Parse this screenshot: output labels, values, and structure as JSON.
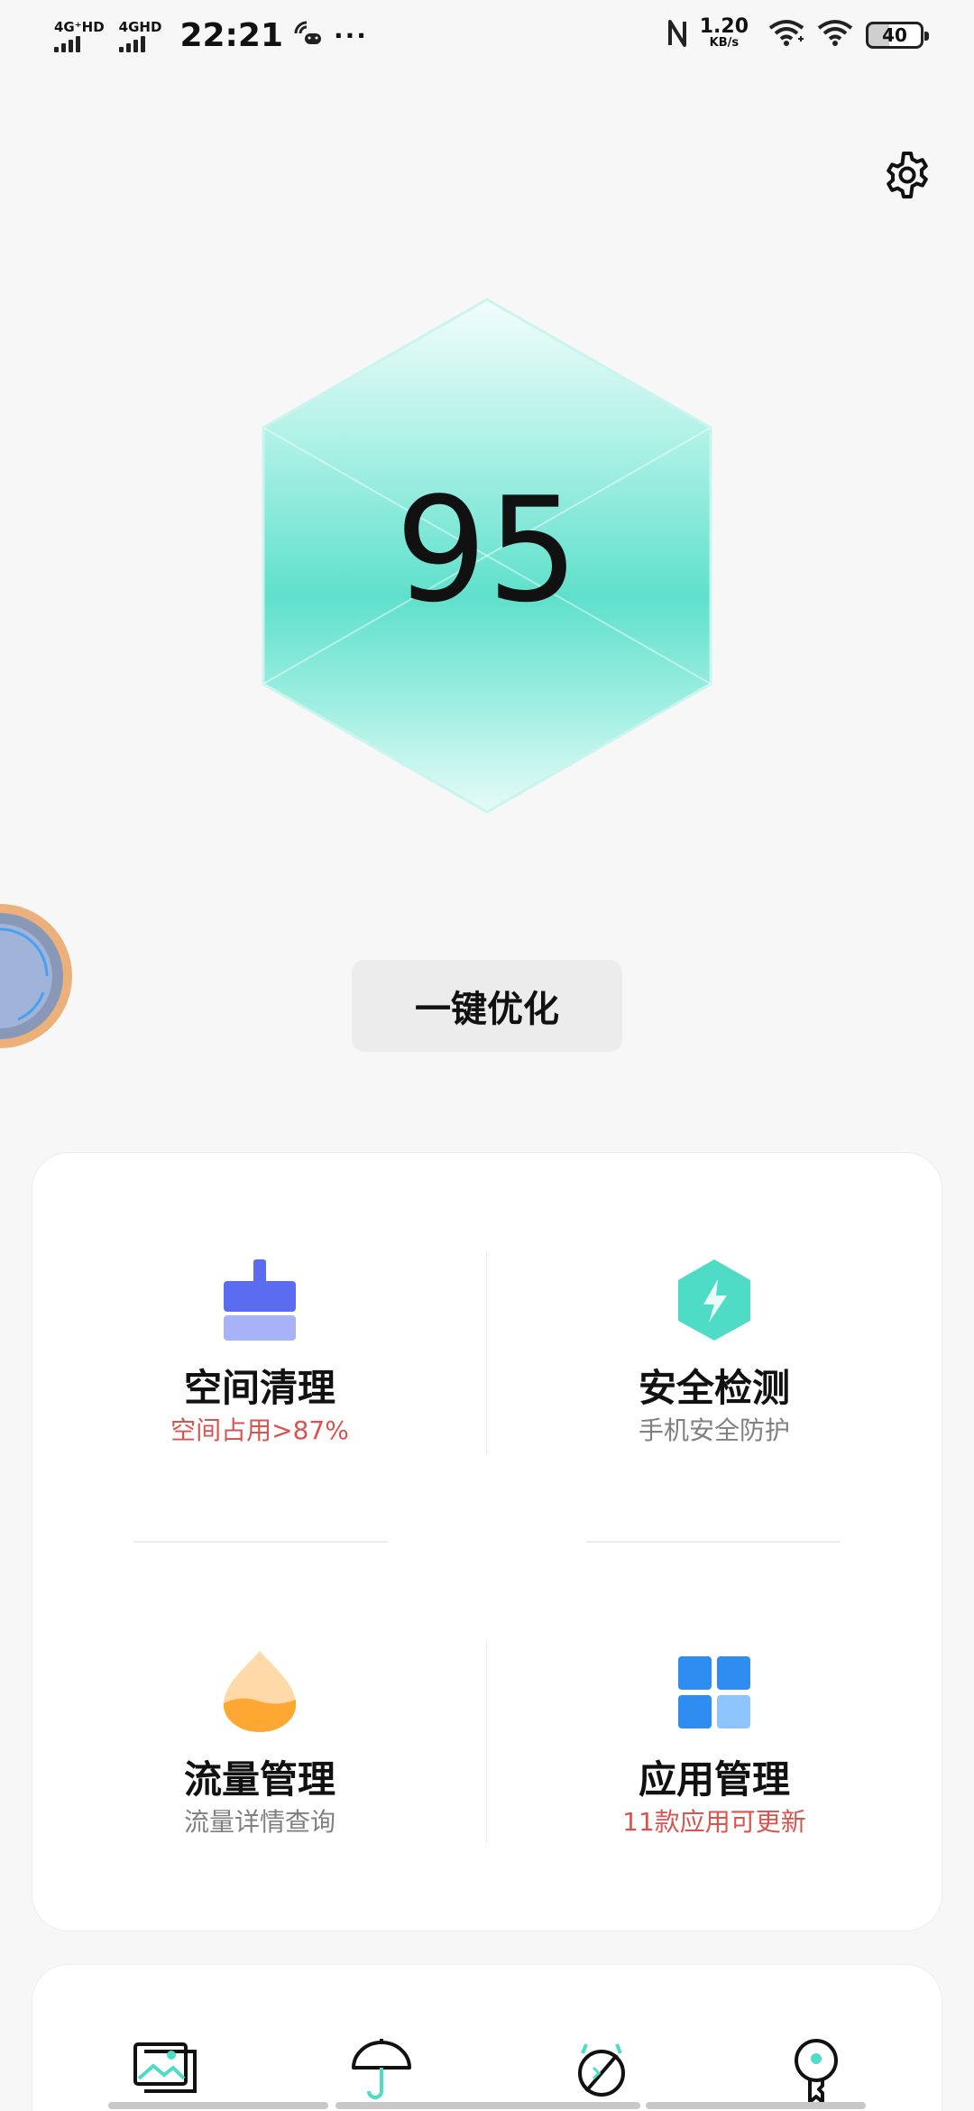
{
  "status_bar": {
    "network_1": "4G⁺HD",
    "network_2": "4GHD",
    "time": "22:21",
    "more": "···",
    "speed_value": "1.20",
    "speed_unit": "KB/s",
    "battery": "40"
  },
  "score": {
    "value": "95"
  },
  "optimize_button": {
    "label": "一键优化"
  },
  "tools": [
    {
      "title": "空间清理",
      "subtitle": "空间占用>87%",
      "subtitle_color": "#d9534f",
      "icon": "broom-icon",
      "icon_colors": [
        "#5b6cf0",
        "#a8b2f7"
      ]
    },
    {
      "title": "安全检测",
      "subtitle": "手机安全防护",
      "subtitle_color": "#808080",
      "icon": "shield-lightning-icon",
      "icon_colors": [
        "#4fdcc6"
      ]
    },
    {
      "title": "流量管理",
      "subtitle": "流量详情查询",
      "subtitle_color": "#808080",
      "icon": "data-drop-icon",
      "icon_colors": [
        "#ffb24a",
        "#ffd9a8"
      ]
    },
    {
      "title": "应用管理",
      "subtitle": "11款应用可更新",
      "subtitle_color": "#d9534f",
      "icon": "apps-grid-icon",
      "icon_colors": [
        "#2f8cf0",
        "#8cc4fb"
      ]
    }
  ],
  "bottom_icons": [
    "photos-icon",
    "umbrella-icon",
    "no-disturb-icon",
    "key-icon"
  ],
  "colors": {
    "accent_teal": "#4fdcc6",
    "warning_red": "#d9534f",
    "background": "#f7f7f7"
  }
}
